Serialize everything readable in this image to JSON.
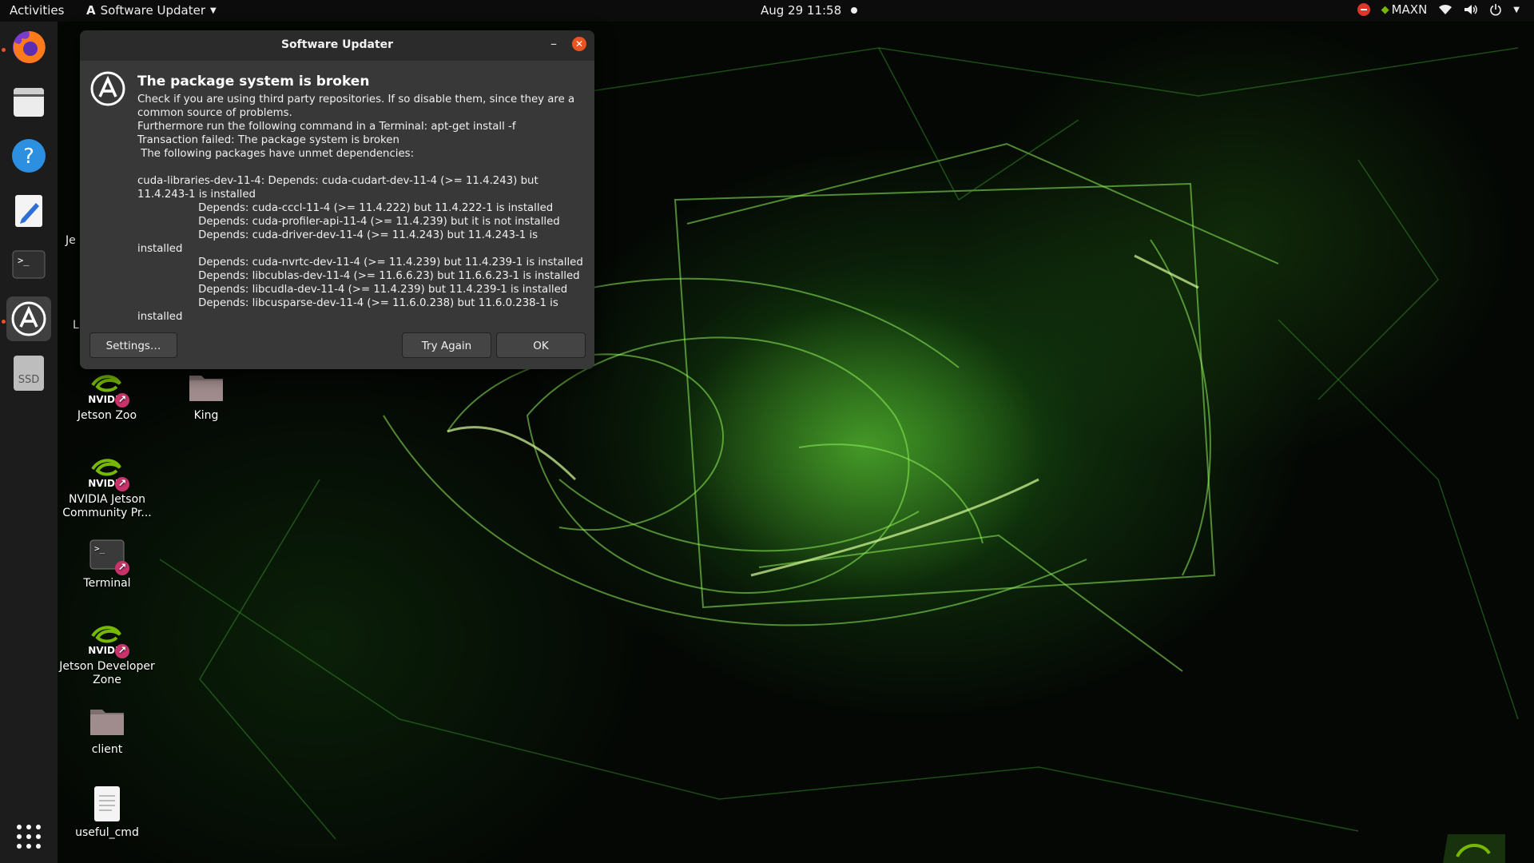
{
  "topbar": {
    "activities": "Activities",
    "app_name": "Software Updater",
    "clock": "Aug 29  11:58",
    "power_mode": "MAXN"
  },
  "dock": {
    "items": [
      {
        "name": "firefox",
        "running": true
      },
      {
        "name": "files",
        "running": false
      },
      {
        "name": "help",
        "running": false
      },
      {
        "name": "text-editor",
        "running": false
      },
      {
        "name": "terminal",
        "running": false
      },
      {
        "name": "software-updater",
        "running": true,
        "active": true
      },
      {
        "name": "ssd-drive",
        "label": "SSD",
        "running": false
      }
    ],
    "show_apps": "show-applications"
  },
  "desktop": {
    "partial_labels": [
      "Je",
      "L"
    ],
    "icons": [
      {
        "label": "Jetson Zoo",
        "type": "nvidia-shortcut"
      },
      {
        "label": "King",
        "type": "folder"
      },
      {
        "label": "NVIDIA Jetson Community Pr...",
        "type": "nvidia-shortcut"
      },
      {
        "label": "Terminal",
        "type": "terminal-shortcut"
      },
      {
        "label": "Jetson Developer Zone",
        "type": "nvidia-shortcut"
      },
      {
        "label": "client",
        "type": "folder"
      },
      {
        "label": "useful_cmd",
        "type": "text-file"
      }
    ]
  },
  "dialog": {
    "title": "Software Updater",
    "heading": "The package system is broken",
    "body": "Check if you are using third party repositories. If so disable them, since they are a common source of problems.\nFurthermore run the following command in a Terminal: apt-get install -f\nTransaction failed: The package system is broken\n The following packages have unmet dependencies:\n\ncuda-libraries-dev-11-4: Depends: cuda-cudart-dev-11-4 (>= 11.4.243) but 11.4.243-1 is installed\n                  Depends: cuda-cccl-11-4 (>= 11.4.222) but 11.4.222-1 is installed\n                  Depends: cuda-profiler-api-11-4 (>= 11.4.239) but it is not installed\n                  Depends: cuda-driver-dev-11-4 (>= 11.4.243) but 11.4.243-1 is installed\n                  Depends: cuda-nvrtc-dev-11-4 (>= 11.4.239) but 11.4.239-1 is installed\n                  Depends: libcublas-dev-11-4 (>= 11.6.6.23) but 11.6.6.23-1 is installed\n                  Depends: libcudla-dev-11-4 (>= 11.4.239) but 11.4.239-1 is installed\n                  Depends: libcusparse-dev-11-4 (>= 11.6.0.238) but 11.6.0.238-1 is\ninstalled",
    "buttons": {
      "settings": "Settings…",
      "try_again": "Try Again",
      "ok": "OK"
    }
  },
  "colors": {
    "accent": "#e95420",
    "shortcut_badge": "#c8336b",
    "nvidia_green": "#76b900"
  }
}
